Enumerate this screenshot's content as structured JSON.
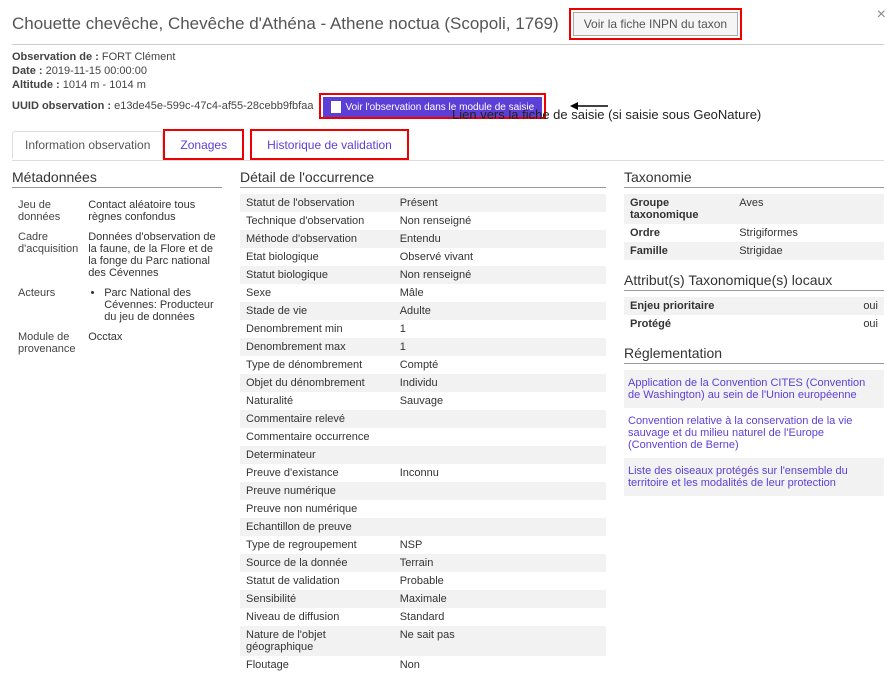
{
  "header": {
    "title": "Chouette chevêche, Chevêche d'Athéna - Athene noctua (Scopoli, 1769)",
    "btn_inpn": "Voir la fiche INPN du taxon"
  },
  "obs": {
    "observer_label": "Observation de :",
    "observer": "FORT Clément",
    "date_label": "Date :",
    "date": "2019-11-15 00:00:00",
    "alt_label": "Altitude :",
    "alt": "1014 m - 1014 m",
    "uuid_label": "UUID observation :",
    "uuid": "e13de45e-599c-47c4-af55-28cebb9fbfaa",
    "btn_module": "Voir l'observation dans le module de saisie"
  },
  "annotation": "Lien vers la fiche de saisie (si saisie sous GeoNature)",
  "tabs": {
    "info": "Information observation",
    "zonages": "Zonages",
    "hist": "Historique de validation"
  },
  "meta": {
    "heading": "Métadonnées",
    "rows": [
      {
        "k": "Jeu de données",
        "v": "Contact aléatoire tous règnes confondus"
      },
      {
        "k": "Cadre d'acquisition",
        "v": "Données d'observation de la faune, de la Flore et de la fonge du Parc national des Cévennes"
      },
      {
        "k": "Acteurs",
        "v": "Parc National des Cévennes: Producteur du jeu de données"
      },
      {
        "k": "Module de provenance",
        "v": "Occtax"
      }
    ]
  },
  "detail": {
    "heading": "Détail de l'occurrence",
    "rows": [
      {
        "k": "Statut de l'observation",
        "v": "Présent"
      },
      {
        "k": "Technique d'observation",
        "v": "Non renseigné"
      },
      {
        "k": "Méthode d'observation",
        "v": "Entendu"
      },
      {
        "k": "Etat biologique",
        "v": "Observé vivant"
      },
      {
        "k": "Statut biologique",
        "v": "Non renseigné"
      },
      {
        "k": "Sexe",
        "v": "Mâle"
      },
      {
        "k": "Stade de vie",
        "v": "Adulte"
      },
      {
        "k": "Denombrement min",
        "v": "1"
      },
      {
        "k": "Denombrement max",
        "v": "1"
      },
      {
        "k": "Type de dénombrement",
        "v": "Compté"
      },
      {
        "k": "Objet du dénombrement",
        "v": "Individu"
      },
      {
        "k": "Naturalité",
        "v": "Sauvage"
      },
      {
        "k": "Commentaire relevé",
        "v": ""
      },
      {
        "k": "Commentaire occurrence",
        "v": ""
      },
      {
        "k": "Determinateur",
        "v": ""
      },
      {
        "k": "Preuve d'existance",
        "v": "Inconnu"
      },
      {
        "k": "Preuve numérique",
        "v": ""
      },
      {
        "k": "Preuve non numérique",
        "v": ""
      },
      {
        "k": "Echantillon de preuve",
        "v": ""
      },
      {
        "k": "Type de regroupement",
        "v": "NSP"
      },
      {
        "k": "Source de la donnée",
        "v": "Terrain"
      },
      {
        "k": "Statut de validation",
        "v": "Probable"
      },
      {
        "k": "Sensibilité",
        "v": "Maximale"
      },
      {
        "k": "Niveau de diffusion",
        "v": "Standard"
      },
      {
        "k": "Nature de l'objet géographique",
        "v": "Ne sait pas"
      },
      {
        "k": "Floutage",
        "v": "Non"
      }
    ]
  },
  "taxo": {
    "heading": "Taxonomie",
    "rows": [
      {
        "k": "Groupe taxonomique",
        "v": "Aves"
      },
      {
        "k": "Ordre",
        "v": "Strigiformes"
      },
      {
        "k": "Famille",
        "v": "Strigidae"
      }
    ]
  },
  "attrs": {
    "heading": "Attribut(s) Taxonomique(s) locaux",
    "rows": [
      {
        "k": "Enjeu prioritaire",
        "v": "oui"
      },
      {
        "k": "Protégé",
        "v": "oui"
      }
    ]
  },
  "regl": {
    "heading": "Réglementation",
    "items": [
      "Application de la Convention CITES (Convention de Washington) au sein de l'Union européenne",
      "Convention relative à la conservation de la vie sauvage et du milieu naturel de l'Europe (Convention de Berne)",
      "Liste des oiseaux protégés sur l'ensemble du territoire et les modalités de leur protection"
    ]
  }
}
